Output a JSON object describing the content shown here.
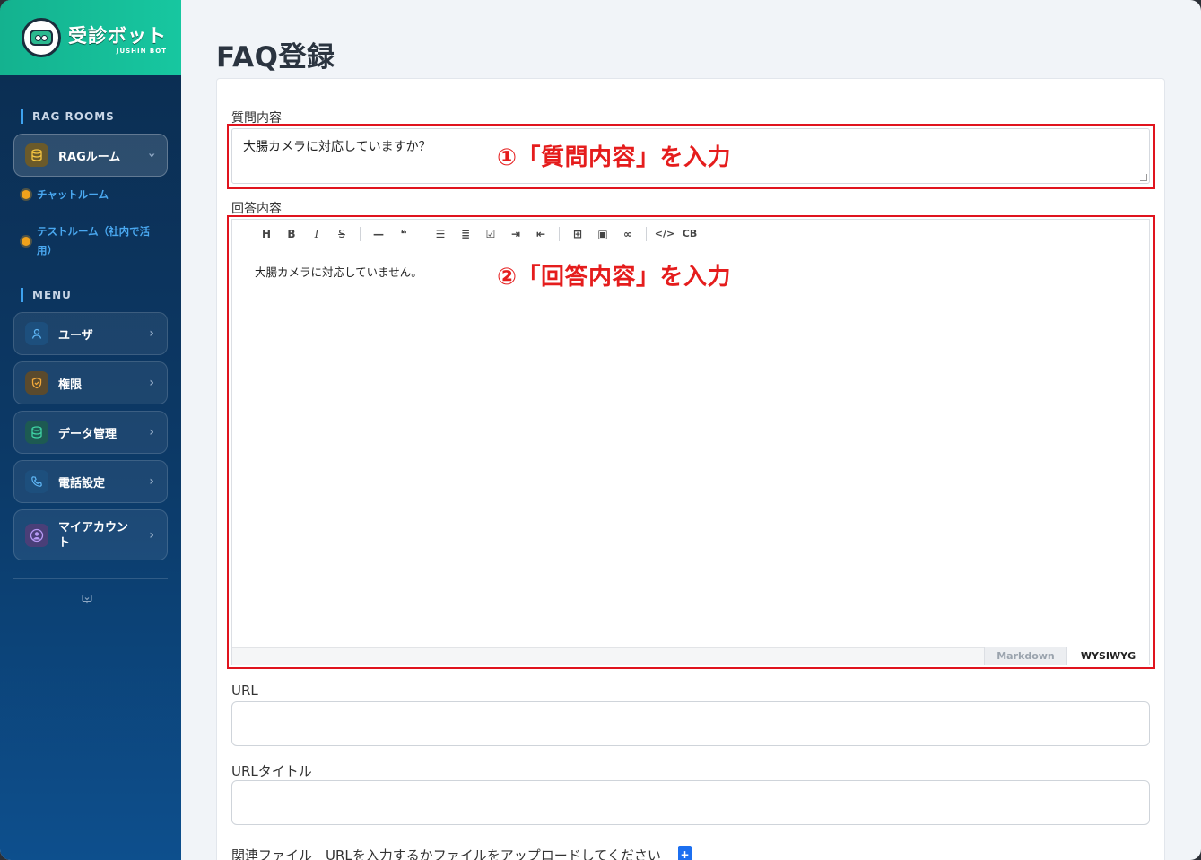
{
  "brand": {
    "title": "受診ボット",
    "subtitle": "JUSHIN BOT"
  },
  "sidebar": {
    "rag_section_label": "RAG ROOMS",
    "rag_button_label": "RAGルーム",
    "rag_sub_items": [
      "チャットルーム",
      "テストルーム（社内で活用）"
    ],
    "menu_section_label": "MENU",
    "menu_items": [
      {
        "label": "ユーザ",
        "icon": "user-icon"
      },
      {
        "label": "権限",
        "icon": "shield-icon"
      },
      {
        "label": "データ管理",
        "icon": "database-icon"
      },
      {
        "label": "電話設定",
        "icon": "phone-icon"
      },
      {
        "label": "マイアカウント",
        "icon": "account-icon"
      }
    ]
  },
  "page": {
    "title": "FAQ登録"
  },
  "form": {
    "question_label": "質問内容",
    "question_value": "大腸カメラに対応していますか？",
    "answer_label": "回答内容",
    "answer_value": "大腸カメラに対応していません。",
    "editor_mode_markdown": "Markdown",
    "editor_mode_wysiwyg": "WYSIWYG",
    "url_label": "URL",
    "url_value": "",
    "url_title_label": "URLタイトル",
    "url_title_value": "",
    "file_label": "関連ファイル　URLを入力するかファイルをアップロードしてください"
  },
  "annotations": {
    "step1": "①「質問内容」を入力",
    "step2": "②「回答内容」を入力",
    "color": "#e51d1d"
  },
  "toolbar_buttons": [
    "H",
    "B",
    "I",
    "S",
    "—",
    "❝",
    "list",
    "ordered-list",
    "task",
    "indent",
    "outdent",
    "table",
    "image",
    "link",
    "code",
    "CB"
  ]
}
